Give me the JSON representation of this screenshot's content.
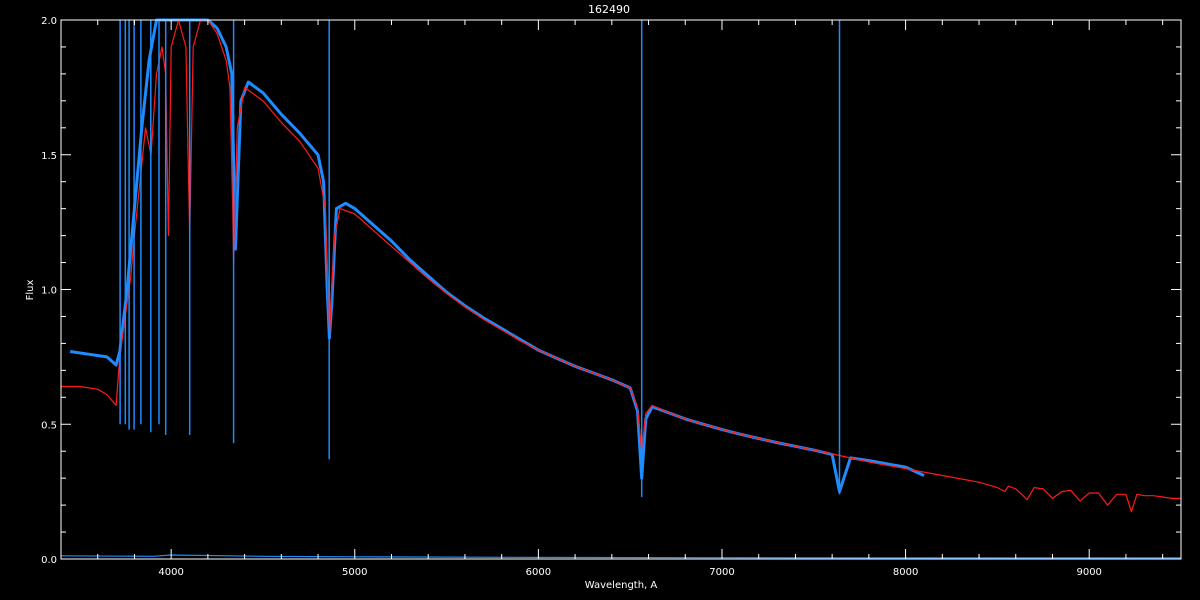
{
  "chart_data": {
    "type": "line",
    "title": "162490",
    "xlabel": "Wavelength, A",
    "ylabel": "Flux",
    "xlim": [
      3400,
      9500
    ],
    "ylim": [
      0.0,
      2.0
    ],
    "grid": false,
    "x_ticks": [
      4000,
      5000,
      6000,
      7000,
      8000,
      9000
    ],
    "x_tick_labels": [
      "4000",
      "5000",
      "6000",
      "7000",
      "8000",
      "9000"
    ],
    "y_ticks": [
      0.0,
      0.5,
      1.0,
      1.5,
      2.0
    ],
    "y_tick_labels": [
      "0.0",
      "0.5",
      "1.0",
      "1.5",
      "2.0"
    ],
    "colors": {
      "background": "#000000",
      "axes": "#ffffff",
      "observed": "#1e8cff",
      "observed_upper": "#ffffff",
      "model": "#ff1a1a",
      "error": "#1e8cff"
    },
    "series": [
      {
        "color": "#1e8cff",
        "x": [
          3450,
          3550,
          3650,
          3700,
          3720,
          3760,
          3800,
          3840,
          3880,
          3920,
          3960,
          4000,
          4050,
          4150,
          4200,
          4250,
          4300,
          4330,
          4350,
          4380,
          4420,
          4460,
          4500,
          4600,
          4700,
          4800,
          4830,
          4850,
          4862,
          4875,
          4900,
          4950,
          5000,
          5100,
          5200,
          5300,
          5400,
          5500,
          5600,
          5700,
          5800,
          5900,
          6000,
          6100,
          6200,
          6300,
          6400,
          6500,
          6540,
          6563,
          6585,
          6620,
          6700,
          6800,
          6900,
          7000,
          7100,
          7200,
          7300,
          7400,
          7500,
          7600,
          7640,
          7700,
          7800,
          7900,
          8000,
          8100
        ],
        "y": [
          0.77,
          0.76,
          0.75,
          0.72,
          0.77,
          1.0,
          1.3,
          1.6,
          1.85,
          2.0,
          2.0,
          2.0,
          2.0,
          2.0,
          2.0,
          1.97,
          1.9,
          1.8,
          1.15,
          1.7,
          1.77,
          1.75,
          1.73,
          1.65,
          1.58,
          1.5,
          1.4,
          1.0,
          0.82,
          0.95,
          1.3,
          1.32,
          1.3,
          1.24,
          1.18,
          1.11,
          1.05,
          0.99,
          0.94,
          0.895,
          0.855,
          0.815,
          0.775,
          0.745,
          0.715,
          0.69,
          0.665,
          0.635,
          0.55,
          0.3,
          0.52,
          0.565,
          0.545,
          0.52,
          0.5,
          0.48,
          0.463,
          0.447,
          0.432,
          0.418,
          0.404,
          0.388,
          0.25,
          0.375,
          0.365,
          0.353,
          0.341,
          0.31
        ]
      },
      {
        "color": "#ff1a1a",
        "x": [
          3400,
          3500,
          3600,
          3650,
          3700,
          3720,
          3740,
          3760,
          3780,
          3800,
          3830,
          3860,
          3890,
          3920,
          3950,
          3970,
          3985,
          4000,
          4040,
          4080,
          4101,
          4120,
          4160,
          4200,
          4250,
          4300,
          4320,
          4335,
          4340,
          4360,
          4400,
          4500,
          4600,
          4700,
          4800,
          4840,
          4855,
          4862,
          4870,
          4890,
          4920,
          5000,
          5100,
          5200,
          5300,
          5400,
          5500,
          5600,
          5700,
          5800,
          5900,
          6000,
          6100,
          6200,
          6300,
          6400,
          6500,
          6540,
          6563,
          6585,
          6620,
          6700,
          6800,
          6900,
          7000,
          7200,
          7400,
          7600,
          7800,
          8000,
          8200,
          8400,
          8500,
          8540,
          8560,
          8600,
          8640,
          8662,
          8700,
          8750,
          8800,
          8850,
          8900,
          8950,
          9000,
          9050,
          9100,
          9150,
          9200,
          9230,
          9260,
          9300,
          9350,
          9400,
          9450,
          9500
        ],
        "y": [
          0.64,
          0.64,
          0.63,
          0.61,
          0.57,
          0.75,
          0.85,
          0.95,
          1.05,
          1.2,
          1.4,
          1.6,
          1.5,
          1.8,
          1.9,
          1.8,
          1.2,
          1.9,
          2.0,
          1.9,
          1.2,
          1.9,
          2.0,
          2.0,
          1.95,
          1.85,
          1.75,
          1.3,
          1.1,
          1.6,
          1.75,
          1.7,
          1.62,
          1.55,
          1.45,
          1.3,
          0.95,
          0.82,
          0.95,
          1.2,
          1.3,
          1.28,
          1.22,
          1.16,
          1.1,
          1.04,
          0.985,
          0.935,
          0.89,
          0.85,
          0.81,
          0.775,
          0.745,
          0.715,
          0.69,
          0.665,
          0.635,
          0.56,
          0.4,
          0.54,
          0.57,
          0.545,
          0.52,
          0.5,
          0.48,
          0.447,
          0.418,
          0.39,
          0.36,
          0.335,
          0.31,
          0.285,
          0.265,
          0.25,
          0.27,
          0.26,
          0.235,
          0.22,
          0.265,
          0.26,
          0.225,
          0.25,
          0.255,
          0.215,
          0.245,
          0.245,
          0.2,
          0.24,
          0.24,
          0.175,
          0.24,
          0.235,
          0.235,
          0.23,
          0.225,
          0.225
        ]
      },
      {
        "color": "#1e8cff",
        "x": [
          3400,
          3900,
          4000,
          4500,
          5000,
          6000,
          7000,
          8000,
          9500
        ],
        "y": [
          0.012,
          0.01,
          0.015,
          0.01,
          0.008,
          0.006,
          0.005,
          0.004,
          0.004
        ]
      }
    ],
    "absorption_lines": [
      {
        "x": 3722,
        "depth_to": 0.5
      },
      {
        "x": 3750,
        "depth_to": 0.5
      },
      {
        "x": 3771,
        "depth_to": 0.48
      },
      {
        "x": 3798,
        "depth_to": 0.48
      },
      {
        "x": 3835,
        "depth_to": 0.5
      },
      {
        "x": 3889,
        "depth_to": 0.47
      },
      {
        "x": 3934,
        "depth_to": 0.5
      },
      {
        "x": 3970,
        "depth_to": 0.46
      },
      {
        "x": 4101,
        "depth_to": 0.46
      },
      {
        "x": 4340,
        "depth_to": 0.43
      },
      {
        "x": 4861,
        "depth_to": 0.37
      },
      {
        "x": 6563,
        "depth_to": 0.23
      },
      {
        "x": 7640,
        "depth_to": 0.24
      }
    ]
  }
}
